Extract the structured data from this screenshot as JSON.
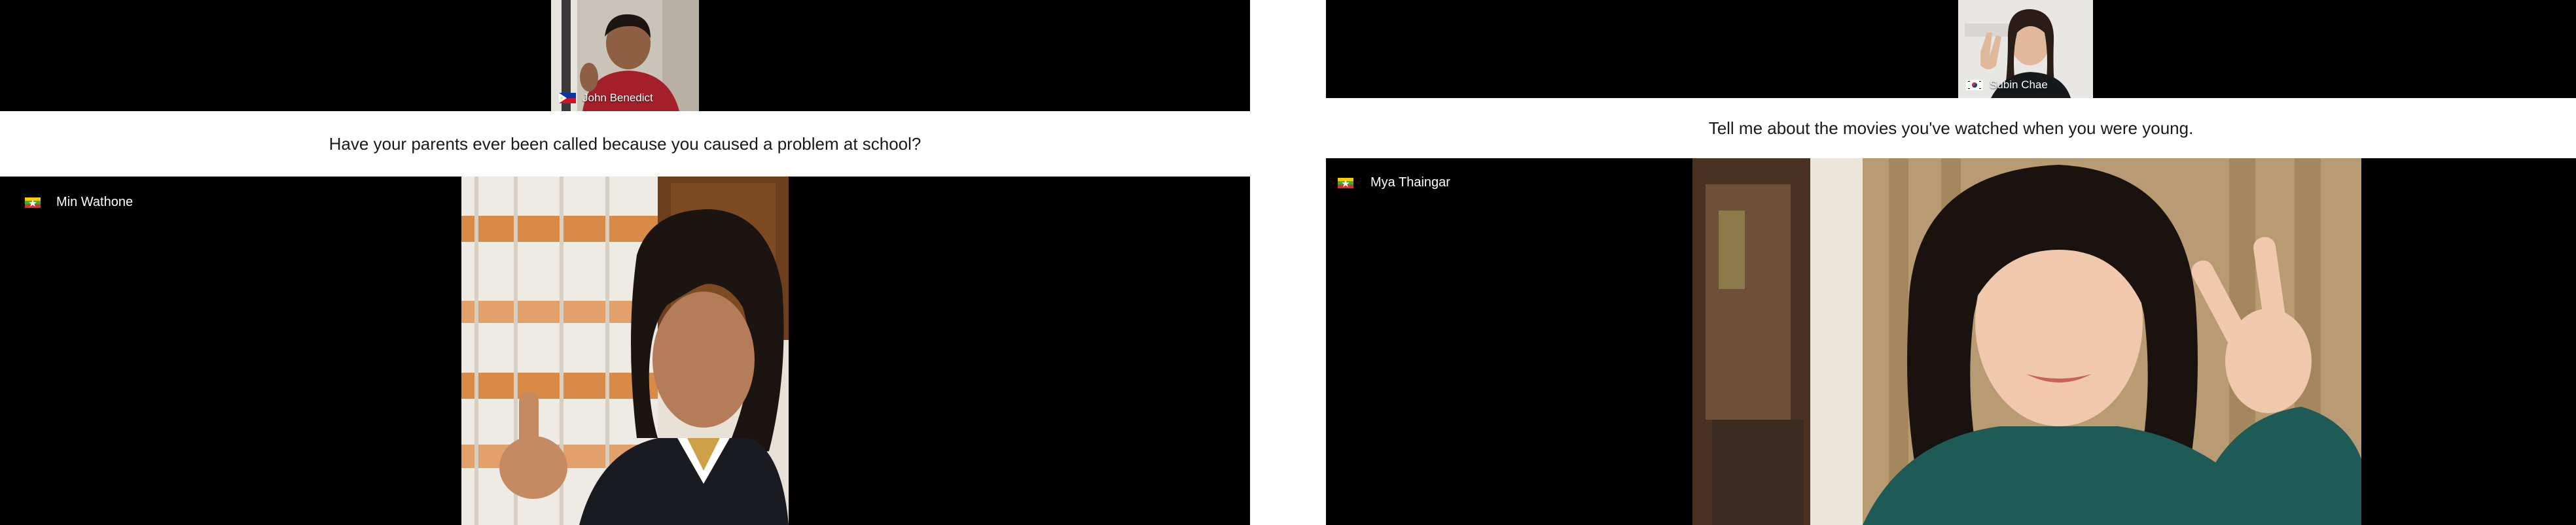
{
  "left_session": {
    "tutor": {
      "name": "John Benedict",
      "flag": "philippines-flag"
    },
    "question": "Have your parents ever been called because you caused a problem at school?",
    "student": {
      "name": "Min Wathone",
      "flag": "myanmar-flag"
    }
  },
  "right_session": {
    "tutor": {
      "name": "Subin Chae",
      "flag": "south-korea-flag"
    },
    "question": "Tell me about the movies you've watched when you were young.",
    "student": {
      "name": "Mya Thaingar",
      "flag": "myanmar-flag"
    }
  },
  "colors": {
    "video_background": "#000000",
    "question_background": "#ffffff",
    "question_text": "#1a1a1a",
    "label_text": "#ffffff",
    "myanmar_flag": [
      "#fecb00",
      "#34b233",
      "#ea2839"
    ]
  }
}
